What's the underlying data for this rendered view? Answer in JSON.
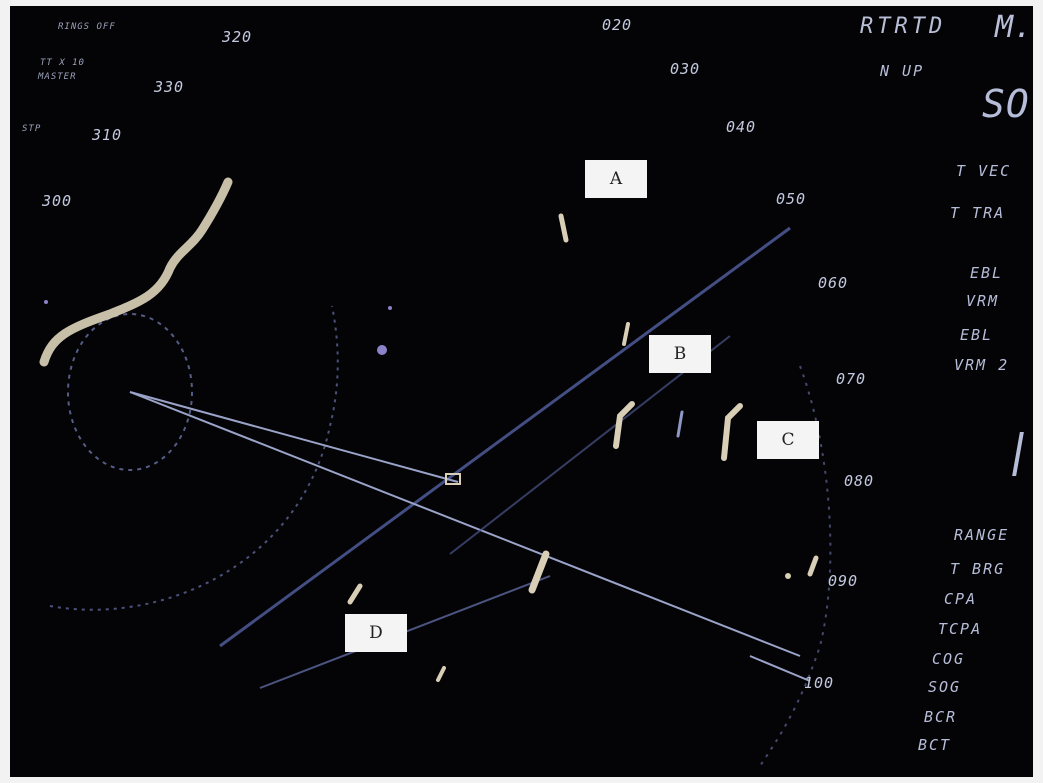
{
  "top_left": [
    "RINGS OFF",
    "TT X 10",
    "MASTER",
    "STP"
  ],
  "top_right": [
    "RTRTD",
    "M.",
    "N UP",
    "SO"
  ],
  "bearings": [
    "320",
    "330",
    "310",
    "300",
    "020",
    "030",
    "040",
    "050",
    "060",
    "070",
    "080",
    "090",
    "100"
  ],
  "side_top": [
    "T VEC",
    "T TRA",
    "EBL",
    "VRM",
    "EBL",
    "VRM 2"
  ],
  "side_bottom": [
    "RANGE",
    "T BRG",
    "CPA",
    "TCPA",
    "COG",
    "SOG",
    "BCR",
    "BCT"
  ],
  "markers": [
    "A",
    "B",
    "C",
    "D"
  ],
  "colors": {
    "screen": "#040406",
    "text": "#b9bfd6",
    "echo": "#d9cfb7",
    "line": "#8e97bf"
  }
}
